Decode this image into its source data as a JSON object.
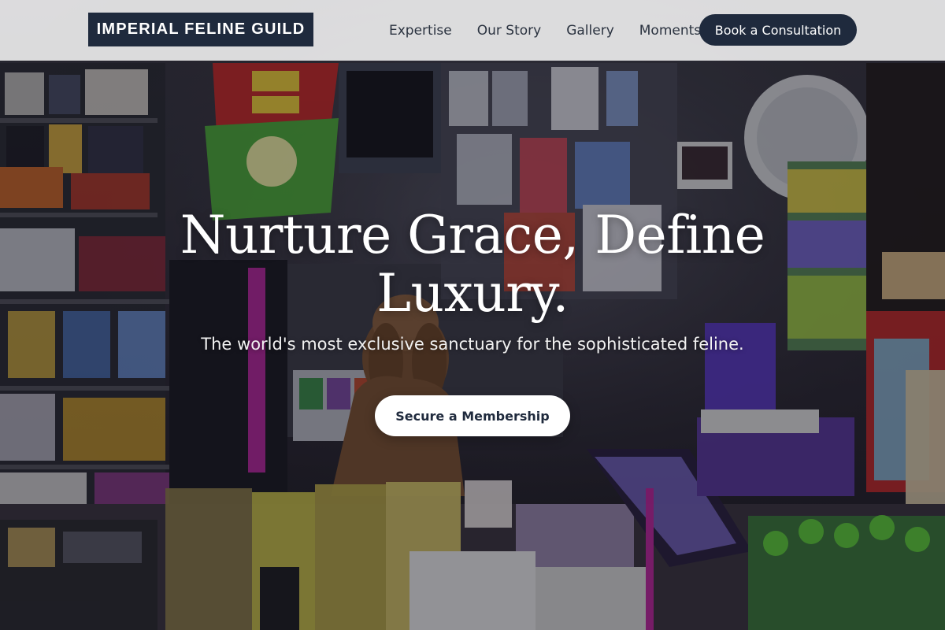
{
  "brand": {
    "name": "IMPERIAL FELINE GUILD"
  },
  "nav": {
    "items": [
      {
        "label": "Expertise"
      },
      {
        "label": "Our Story"
      },
      {
        "label": "Gallery"
      },
      {
        "label": "Moments"
      }
    ],
    "cta_label": "Book a Consultation"
  },
  "hero": {
    "headline": "Nurture Grace, Define Luxury.",
    "subtitle": "The world's most exclusive sanctuary for the sophisticated feline.",
    "cta_label": "Secure a Membership"
  },
  "colors": {
    "brand_navy": "#1f2a3d",
    "header_bg": "#f5f5f5",
    "hero_text": "#ffffff",
    "cta_bg": "#ffffff"
  }
}
